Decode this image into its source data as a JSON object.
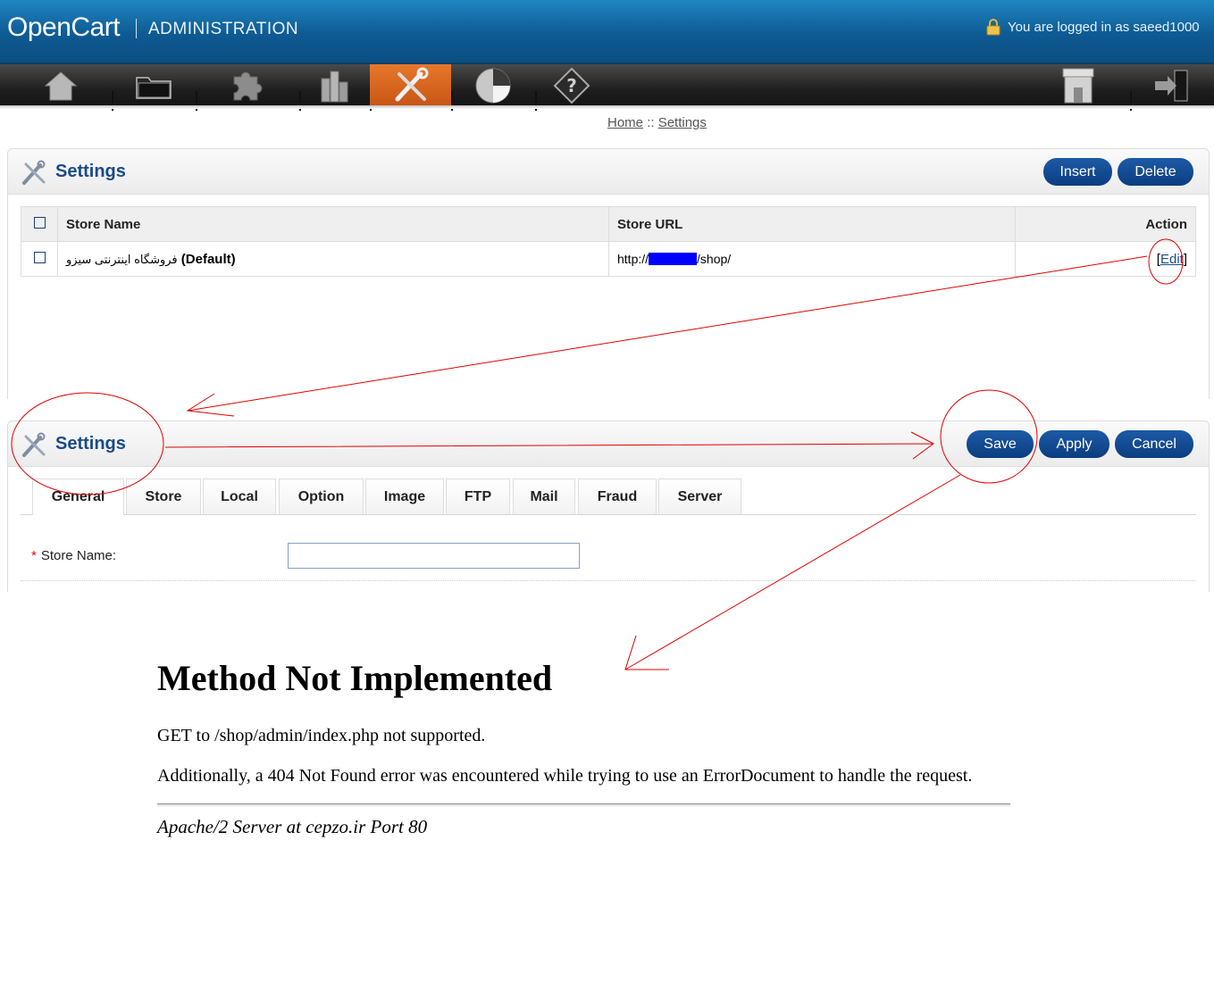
{
  "header": {
    "logo_main": "OpenCart",
    "logo_sub": "ADMINISTRATION",
    "login_text": "You are logged in as saeed1000"
  },
  "menu": {
    "items": [
      {
        "name": "home",
        "icon": "home-icon"
      },
      {
        "name": "catalog",
        "icon": "folder-icon"
      },
      {
        "name": "extensions",
        "icon": "puzzle-icon"
      },
      {
        "name": "sales",
        "icon": "coins-icon"
      },
      {
        "name": "system",
        "icon": "tools-icon",
        "active": true
      },
      {
        "name": "reports",
        "icon": "pie-chart-icon"
      },
      {
        "name": "help",
        "icon": "help-icon"
      },
      {
        "name": "store-front",
        "icon": "store-icon"
      },
      {
        "name": "logout",
        "icon": "logout-icon"
      }
    ],
    "active_color": "#d9621f"
  },
  "breadcrumb": {
    "home": "Home",
    "separator": "::",
    "current": "Settings"
  },
  "list_panel": {
    "title": "Settings",
    "insert_label": "Insert",
    "delete_label": "Delete",
    "columns": {
      "name": "Store Name",
      "url": "Store URL",
      "action": "Action"
    },
    "rows": [
      {
        "name": "فروشگاه اینترنتی سیزو",
        "default_suffix": "(Default)",
        "url_prefix": "http://",
        "url_suffix": "/shop/",
        "action_open": "[",
        "action_label": "Edit",
        "action_close": "]"
      }
    ]
  },
  "form_panel": {
    "title": "Settings",
    "save_label": "Save",
    "apply_label": "Apply",
    "cancel_label": "Cancel",
    "tabs": [
      "General",
      "Store",
      "Local",
      "Option",
      "Image",
      "FTP",
      "Mail",
      "Fraud",
      "Server"
    ],
    "active_tab": "General",
    "fields": {
      "required_mark": "*",
      "store_name_label": "Store Name:",
      "store_name_value": ""
    }
  },
  "error_page": {
    "title": "Method Not Implemented",
    "line1": "GET to /shop/admin/index.php not supported.",
    "line2": "Additionally, a 404 Not Found error was encountered while trying to use an ErrorDocument to handle the request.",
    "address": "Apache/2 Server at cepzo.ir Port 80"
  },
  "colors": {
    "header_blue": "#0e5a93",
    "button_blue": "#0b3d80",
    "title_blue": "#1a4b86",
    "annotation_red": "#e00000",
    "redaction_blue": "#0000ff"
  }
}
